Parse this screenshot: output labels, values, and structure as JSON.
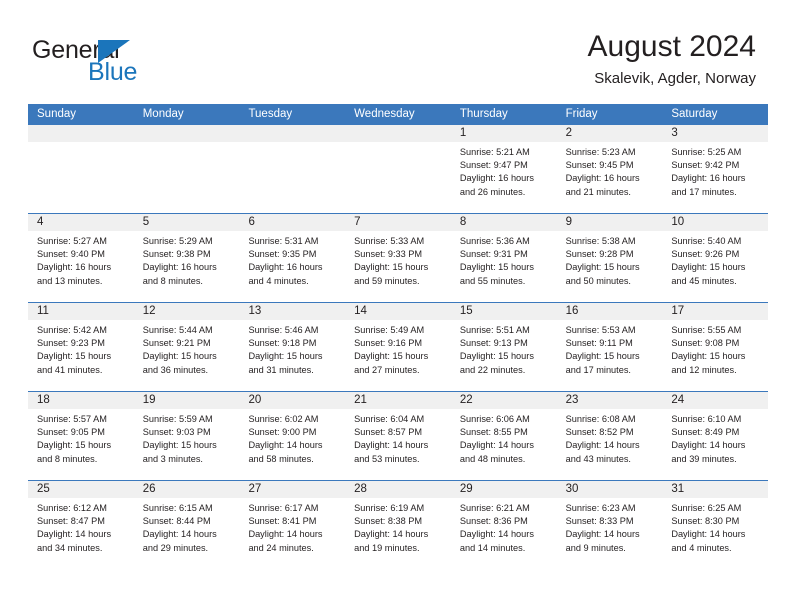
{
  "brand": {
    "name_part1": "General",
    "name_part2": "Blue",
    "triangle_color": "#1b75bb",
    "text_color": "#231f20"
  },
  "header": {
    "month_title": "August 2024",
    "location": "Skalevik, Agder, Norway"
  },
  "calendar": {
    "header_bg": "#3b78bc",
    "header_text_color": "#ffffff",
    "daynum_bg": "#f0f0f0",
    "weekdays": [
      "Sunday",
      "Monday",
      "Tuesday",
      "Wednesday",
      "Thursday",
      "Friday",
      "Saturday"
    ],
    "weeks": [
      [
        {
          "day": "",
          "lines": []
        },
        {
          "day": "",
          "lines": []
        },
        {
          "day": "",
          "lines": []
        },
        {
          "day": "",
          "lines": []
        },
        {
          "day": "1",
          "lines": [
            "Sunrise: 5:21 AM",
            "Sunset: 9:47 PM",
            "Daylight: 16 hours",
            "and 26 minutes."
          ]
        },
        {
          "day": "2",
          "lines": [
            "Sunrise: 5:23 AM",
            "Sunset: 9:45 PM",
            "Daylight: 16 hours",
            "and 21 minutes."
          ]
        },
        {
          "day": "3",
          "lines": [
            "Sunrise: 5:25 AM",
            "Sunset: 9:42 PM",
            "Daylight: 16 hours",
            "and 17 minutes."
          ]
        }
      ],
      [
        {
          "day": "4",
          "lines": [
            "Sunrise: 5:27 AM",
            "Sunset: 9:40 PM",
            "Daylight: 16 hours",
            "and 13 minutes."
          ]
        },
        {
          "day": "5",
          "lines": [
            "Sunrise: 5:29 AM",
            "Sunset: 9:38 PM",
            "Daylight: 16 hours",
            "and 8 minutes."
          ]
        },
        {
          "day": "6",
          "lines": [
            "Sunrise: 5:31 AM",
            "Sunset: 9:35 PM",
            "Daylight: 16 hours",
            "and 4 minutes."
          ]
        },
        {
          "day": "7",
          "lines": [
            "Sunrise: 5:33 AM",
            "Sunset: 9:33 PM",
            "Daylight: 15 hours",
            "and 59 minutes."
          ]
        },
        {
          "day": "8",
          "lines": [
            "Sunrise: 5:36 AM",
            "Sunset: 9:31 PM",
            "Daylight: 15 hours",
            "and 55 minutes."
          ]
        },
        {
          "day": "9",
          "lines": [
            "Sunrise: 5:38 AM",
            "Sunset: 9:28 PM",
            "Daylight: 15 hours",
            "and 50 minutes."
          ]
        },
        {
          "day": "10",
          "lines": [
            "Sunrise: 5:40 AM",
            "Sunset: 9:26 PM",
            "Daylight: 15 hours",
            "and 45 minutes."
          ]
        }
      ],
      [
        {
          "day": "11",
          "lines": [
            "Sunrise: 5:42 AM",
            "Sunset: 9:23 PM",
            "Daylight: 15 hours",
            "and 41 minutes."
          ]
        },
        {
          "day": "12",
          "lines": [
            "Sunrise: 5:44 AM",
            "Sunset: 9:21 PM",
            "Daylight: 15 hours",
            "and 36 minutes."
          ]
        },
        {
          "day": "13",
          "lines": [
            "Sunrise: 5:46 AM",
            "Sunset: 9:18 PM",
            "Daylight: 15 hours",
            "and 31 minutes."
          ]
        },
        {
          "day": "14",
          "lines": [
            "Sunrise: 5:49 AM",
            "Sunset: 9:16 PM",
            "Daylight: 15 hours",
            "and 27 minutes."
          ]
        },
        {
          "day": "15",
          "lines": [
            "Sunrise: 5:51 AM",
            "Sunset: 9:13 PM",
            "Daylight: 15 hours",
            "and 22 minutes."
          ]
        },
        {
          "day": "16",
          "lines": [
            "Sunrise: 5:53 AM",
            "Sunset: 9:11 PM",
            "Daylight: 15 hours",
            "and 17 minutes."
          ]
        },
        {
          "day": "17",
          "lines": [
            "Sunrise: 5:55 AM",
            "Sunset: 9:08 PM",
            "Daylight: 15 hours",
            "and 12 minutes."
          ]
        }
      ],
      [
        {
          "day": "18",
          "lines": [
            "Sunrise: 5:57 AM",
            "Sunset: 9:05 PM",
            "Daylight: 15 hours",
            "and 8 minutes."
          ]
        },
        {
          "day": "19",
          "lines": [
            "Sunrise: 5:59 AM",
            "Sunset: 9:03 PM",
            "Daylight: 15 hours",
            "and 3 minutes."
          ]
        },
        {
          "day": "20",
          "lines": [
            "Sunrise: 6:02 AM",
            "Sunset: 9:00 PM",
            "Daylight: 14 hours",
            "and 58 minutes."
          ]
        },
        {
          "day": "21",
          "lines": [
            "Sunrise: 6:04 AM",
            "Sunset: 8:57 PM",
            "Daylight: 14 hours",
            "and 53 minutes."
          ]
        },
        {
          "day": "22",
          "lines": [
            "Sunrise: 6:06 AM",
            "Sunset: 8:55 PM",
            "Daylight: 14 hours",
            "and 48 minutes."
          ]
        },
        {
          "day": "23",
          "lines": [
            "Sunrise: 6:08 AM",
            "Sunset: 8:52 PM",
            "Daylight: 14 hours",
            "and 43 minutes."
          ]
        },
        {
          "day": "24",
          "lines": [
            "Sunrise: 6:10 AM",
            "Sunset: 8:49 PM",
            "Daylight: 14 hours",
            "and 39 minutes."
          ]
        }
      ],
      [
        {
          "day": "25",
          "lines": [
            "Sunrise: 6:12 AM",
            "Sunset: 8:47 PM",
            "Daylight: 14 hours",
            "and 34 minutes."
          ]
        },
        {
          "day": "26",
          "lines": [
            "Sunrise: 6:15 AM",
            "Sunset: 8:44 PM",
            "Daylight: 14 hours",
            "and 29 minutes."
          ]
        },
        {
          "day": "27",
          "lines": [
            "Sunrise: 6:17 AM",
            "Sunset: 8:41 PM",
            "Daylight: 14 hours",
            "and 24 minutes."
          ]
        },
        {
          "day": "28",
          "lines": [
            "Sunrise: 6:19 AM",
            "Sunset: 8:38 PM",
            "Daylight: 14 hours",
            "and 19 minutes."
          ]
        },
        {
          "day": "29",
          "lines": [
            "Sunrise: 6:21 AM",
            "Sunset: 8:36 PM",
            "Daylight: 14 hours",
            "and 14 minutes."
          ]
        },
        {
          "day": "30",
          "lines": [
            "Sunrise: 6:23 AM",
            "Sunset: 8:33 PM",
            "Daylight: 14 hours",
            "and 9 minutes."
          ]
        },
        {
          "day": "31",
          "lines": [
            "Sunrise: 6:25 AM",
            "Sunset: 8:30 PM",
            "Daylight: 14 hours",
            "and 4 minutes."
          ]
        }
      ]
    ]
  }
}
